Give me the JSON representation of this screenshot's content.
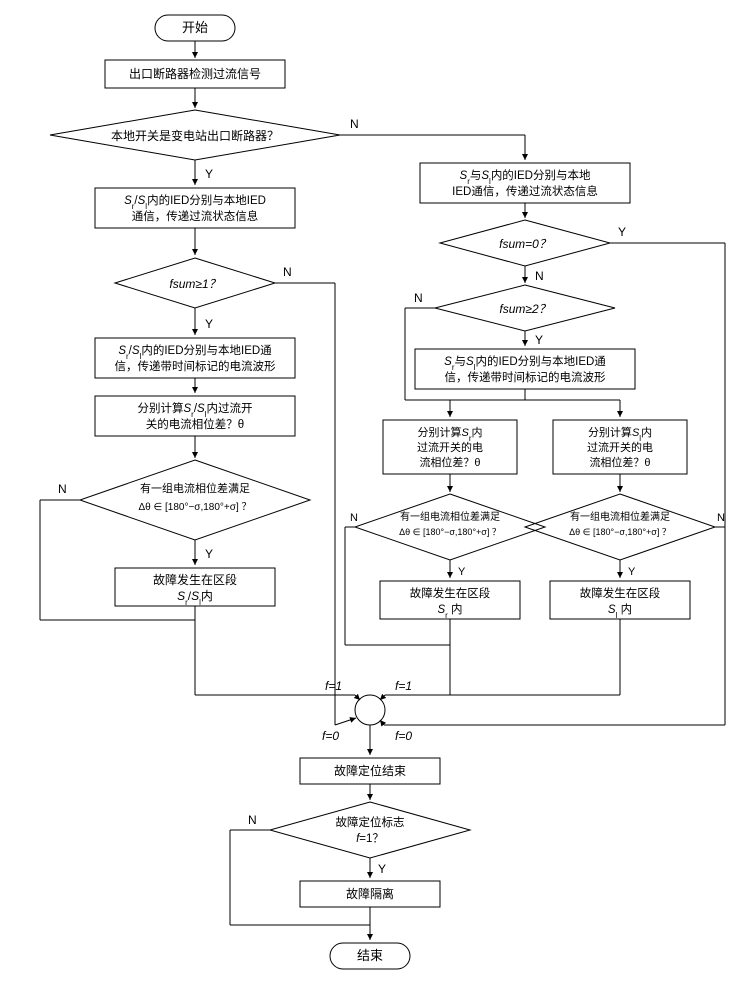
{
  "nodes": {
    "start": "开始",
    "detect": "出口断路器检测过流信号",
    "d1": "本地开关是变电站出口断路器？",
    "leftComm": "Sr/Sl内的IED分别与本地IED通信，传递过流状态信息",
    "rightComm": "Sr与Sl内的IED分别与本地IED通信，传递过流状态信息",
    "d_fsum1": "fsum≥1？",
    "d_fsum0": "fsum=0？",
    "d_fsum2": "fsum≥2？",
    "leftComm2": "Sr/Sl内的IED分别与本地IED通信，传递带时间标记的电流波形",
    "rightComm2": "Sr与Sl内的IED分别与本地IED通信，传递带时间标记的电流波形",
    "leftCalc": "分别计算Sr/Sl内过流开关的电流相位差？θ",
    "rightCalcSr": "分别计算Sr内过流开关的电流相位差？θ",
    "rightCalcSl": "分别计算Sl内过流开关的电流相位差？θ",
    "phaseCond": "有一组电流相位差满足",
    "phaseExpr": "Δθ ∈ [180°−σ, 180°+σ] ？",
    "faultSrSl": "故障发生在区段 Sr/Sl 内",
    "faultSr": "故障发生在区段 Sr 内",
    "faultSl": "故障发生在区段 Sl 内",
    "locEnd": "故障定位结束",
    "d_flag": "故障定位标志 f=1？",
    "isolate": "故障隔离",
    "end": "结束"
  },
  "labels": {
    "Y": "Y",
    "N": "N",
    "f1": "f=1",
    "f0": "f=0"
  }
}
